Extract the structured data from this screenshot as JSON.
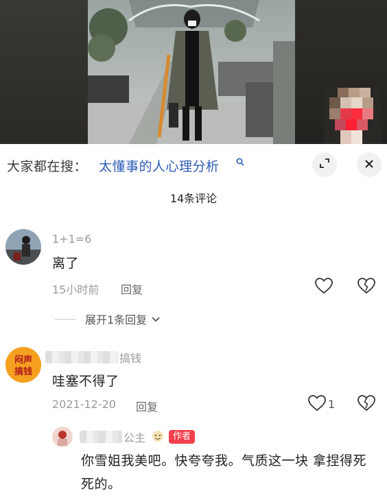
{
  "search": {
    "prefix": "大家都在搜：",
    "query": "太懂事的人心理分析",
    "search_icon": "search-icon",
    "expand_icon": "expand-icon",
    "close_icon": "close-icon"
  },
  "comments_header": {
    "title": "14条评论"
  },
  "comments": [
    {
      "username": "1+1=6",
      "text": "离了",
      "time": "15小时前",
      "reply_label": "回复",
      "like_count": "",
      "expand_replies": "展开1条回复"
    },
    {
      "username_suffix": "搞钱",
      "avatar_text": "闷声搞钱",
      "text": "哇塞不得了",
      "time": "2021-12-20",
      "reply_label": "回复",
      "like_count": "1"
    }
  ],
  "author_reply": {
    "username_suffix": "公主",
    "badge": "作者",
    "text": "你雪姐我美吧。快夸夸我。气质这一块 拿捏得死死的。"
  },
  "colors": {
    "link": "#2e5bb8",
    "badge": "#f2414d",
    "muted": "#9a9a9a"
  }
}
